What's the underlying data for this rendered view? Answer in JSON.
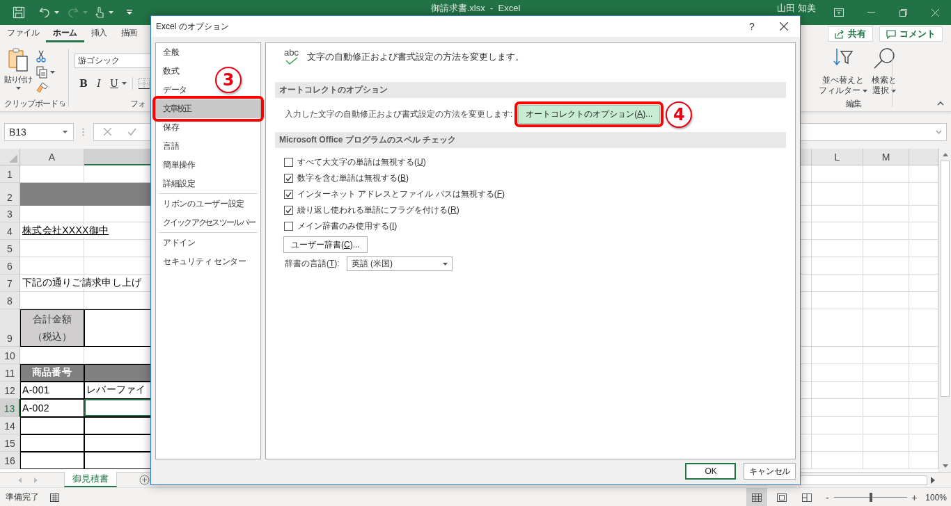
{
  "title_bar": {
    "title": "御請求書.xlsx  -  Excel",
    "user": "山田 知美"
  },
  "ribbon_tabs": [
    {
      "label": "ファイル",
      "selected": false
    },
    {
      "label": "ホーム",
      "selected": true
    },
    {
      "label": "挿入",
      "selected": false
    },
    {
      "label": "描画",
      "selected": false
    }
  ],
  "share_button": "共有",
  "comment_button": "コメント",
  "ribbon": {
    "paste": "貼り付け",
    "clipboard_group": "クリップボード",
    "font_name": "游ゴシック",
    "font_buttons": [
      {
        "label": "B",
        "kind": "bold"
      },
      {
        "label": "I",
        "kind": "italic"
      },
      {
        "label": "U",
        "kind": "underline"
      }
    ],
    "font_group": "フォ",
    "sort_filter": [
      "並べ替えと",
      "フィルター"
    ],
    "find_select": [
      "検索と",
      "選択"
    ],
    "editing_group": "編集"
  },
  "formula_bar": {
    "name_box": "B13"
  },
  "sheet": {
    "columns": [
      {
        "label": "A",
        "selected": false
      },
      {
        "selected": true
      },
      {
        "selected": false
      },
      {
        "label": "L",
        "selected": false
      },
      {
        "label": "M",
        "selected": false
      },
      {
        "selected": false
      }
    ],
    "rows": [
      {
        "number": "1",
        "selected": false,
        "kind": "plain",
        "cells": [
          {
            "kind": "blank",
            "selected": false
          },
          {
            "kind": "blank",
            "selected": false
          }
        ]
      },
      {
        "number": "2",
        "selected": false,
        "kind": "plain",
        "cells": [
          {
            "kind": "band",
            "selected": false
          },
          {
            "kind": "band",
            "selected": false
          }
        ]
      },
      {
        "number": "3",
        "selected": false,
        "kind": "plain",
        "cells": [
          {
            "kind": "blank",
            "selected": false
          },
          {
            "kind": "blank",
            "selected": false
          }
        ]
      },
      {
        "number": "4",
        "selected": false,
        "kind": "plain",
        "cells": [
          {
            "kind": "underlined",
            "text": "株式会社XXXX御中",
            "selected": false
          },
          {
            "kind": "blank",
            "selected": false
          }
        ]
      },
      {
        "number": "5",
        "selected": false,
        "kind": "plain",
        "cells": [
          {
            "kind": "blank",
            "selected": false
          },
          {
            "kind": "blank",
            "selected": false
          }
        ]
      },
      {
        "number": "6",
        "selected": false,
        "kind": "plain",
        "cells": [
          {
            "kind": "blank",
            "selected": false
          },
          {
            "kind": "blank",
            "selected": false
          }
        ]
      },
      {
        "number": "7",
        "selected": false,
        "kind": "plain",
        "cells": [
          {
            "kind": "text",
            "text": "下記の通りご請求申し上げ",
            "selected": false
          },
          {
            "kind": "blank",
            "selected": false
          }
        ]
      },
      {
        "number": "8",
        "selected": false,
        "kind": "plain",
        "cells": [
          {
            "kind": "blank",
            "selected": false
          },
          {
            "kind": "blank",
            "selected": false
          }
        ]
      },
      {
        "number": "9",
        "selected": false,
        "kind": "table",
        "cells": [
          {
            "kind": "shaded",
            "text": "合計金額（税込）",
            "selected": false
          },
          {
            "kind": "blank",
            "selected": false
          }
        ]
      },
      {
        "number": "10",
        "selected": false,
        "kind": "plain",
        "cells": [
          {
            "kind": "blank",
            "selected": false
          },
          {
            "kind": "blank",
            "selected": false
          }
        ]
      },
      {
        "number": "11",
        "selected": false,
        "kind": "table",
        "cells": [
          {
            "kind": "header",
            "text": "商品番号",
            "selected": false
          },
          {
            "kind": "header",
            "selected": false
          }
        ]
      },
      {
        "number": "12",
        "selected": false,
        "kind": "table",
        "cells": [
          {
            "kind": "text",
            "text": "A-001",
            "selected": false
          },
          {
            "kind": "text",
            "text": "レバーファイ",
            "selected": false
          }
        ]
      },
      {
        "number": "13",
        "selected": true,
        "kind": "table",
        "cells": [
          {
            "kind": "text",
            "text": "A-002",
            "selected": false
          },
          {
            "kind": "blank",
            "selected": true
          }
        ]
      },
      {
        "number": "14",
        "selected": false,
        "kind": "table",
        "cells": [
          {
            "kind": "blank",
            "selected": false
          },
          {
            "kind": "blank",
            "selected": false
          }
        ]
      },
      {
        "number": "15",
        "selected": false,
        "kind": "table",
        "cells": [
          {
            "kind": "blank",
            "selected": false
          },
          {
            "kind": "blank",
            "selected": false
          }
        ]
      },
      {
        "number": "16",
        "selected": false,
        "kind": "table",
        "cells": [
          {
            "kind": "blank",
            "selected": false
          },
          {
            "kind": "blank",
            "selected": false
          }
        ]
      }
    ]
  },
  "sheet_tabs": [
    {
      "label": "御見積書",
      "selected": true
    }
  ],
  "status_bar": {
    "status": "準備完了",
    "views": [
      {
        "kind": "normal",
        "selected": true
      },
      {
        "kind": "page-layout",
        "selected": false
      },
      {
        "kind": "page-break",
        "selected": false
      }
    ],
    "zoom_out": "-",
    "zoom_in": "+",
    "zoom": {
      "level": 0.5,
      "reading": "100%"
    }
  },
  "dialog": {
    "title": "Excel のオプション",
    "help": "?",
    "nav_groups": [
      [
        {
          "label": "全般",
          "selected": false,
          "highlighted": false
        },
        {
          "label": "数式",
          "selected": false,
          "highlighted": false
        },
        {
          "label": "データ",
          "selected": false,
          "highlighted": false
        },
        {
          "label": "文章校正",
          "selected": true,
          "highlighted": true,
          "callout": "3"
        },
        {
          "label": "保存",
          "selected": false,
          "highlighted": false
        },
        {
          "label": "言語",
          "selected": false,
          "highlighted": false
        },
        {
          "label": "簡単操作",
          "selected": false,
          "highlighted": false
        },
        {
          "label": "詳細設定",
          "selected": false,
          "highlighted": false
        }
      ],
      [
        {
          "label": "リボンのユーザー設定",
          "selected": false,
          "highlighted": false
        },
        {
          "label": "クイック アクセス ツール バー",
          "selected": false,
          "highlighted": false
        }
      ],
      [
        {
          "label": "アドイン",
          "selected": false,
          "highlighted": false
        },
        {
          "label": "セキュリティ センター",
          "selected": false,
          "highlighted": false
        }
      ]
    ],
    "intro_icon": "abc",
    "intro": "文字の自動修正および書式設定の方法を変更します。",
    "autocorrect": {
      "heading": "オートコレクトのオプション",
      "description": "入力した文字の自動修正および書式設定の方法を変更します:",
      "button": {
        "label": [
          "オートコレクトのオプション(",
          "A",
          ")..."
        ],
        "highlighted": true,
        "callout": "4"
      }
    },
    "spelling": {
      "heading": "Microsoft Office プログラムのスペル チェック",
      "options": [
        {
          "label": [
            "すべて大文字の単語は無視する(",
            "U",
            ")"
          ],
          "checked": false
        },
        {
          "label": [
            "数字を含む単語は無視する(",
            "B",
            ")"
          ],
          "checked": true
        },
        {
          "label": [
            "インターネット アドレスとファイル パスは無視する(",
            "F",
            ")"
          ],
          "checked": true
        },
        {
          "label": [
            "繰り返し使われる単語にフラグを付ける(",
            "R",
            ")"
          ],
          "checked": true
        },
        {
          "label": [
            "メイン辞書のみ使用する(",
            "I",
            ")"
          ],
          "checked": false
        }
      ],
      "dictionary_button": [
        "ユーザー辞書(",
        "C",
        ")..."
      ],
      "language_label": [
        "辞書の言語(",
        "T",
        "):"
      ],
      "language": "英語 (米国)"
    },
    "buttons": [
      {
        "label": "OK",
        "default": true
      },
      {
        "label": "キャンセル",
        "default": false
      }
    ]
  }
}
